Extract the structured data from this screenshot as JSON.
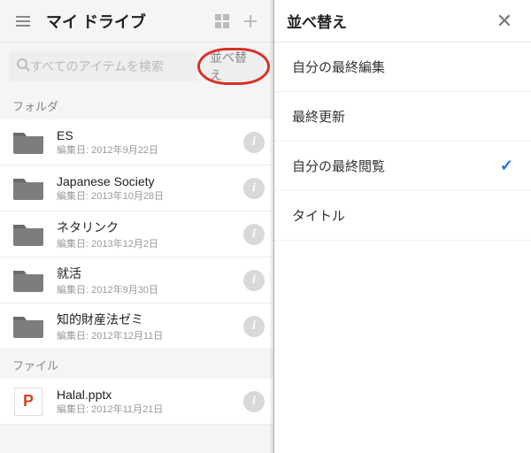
{
  "header": {
    "title": "マイ ドライブ"
  },
  "search": {
    "placeholder": "すべてのアイテムを検索",
    "sort_label": "並べ替え"
  },
  "sections": {
    "folders_label": "フォルダ",
    "files_label": "ファイル"
  },
  "folders": [
    {
      "title": "ES",
      "sub": "編集日: 2012年9月22日"
    },
    {
      "title": "Japanese Society",
      "sub": "編集日: 2013年10月28日"
    },
    {
      "title": "ネタリンク",
      "sub": "編集日: 2013年12月2日"
    },
    {
      "title": "就活",
      "sub": "編集日: 2012年9月30日"
    },
    {
      "title": "知的財産法ゼミ",
      "sub": "編集日: 2012年12月11日"
    }
  ],
  "files": [
    {
      "title": "Halal.pptx",
      "sub": "編集日: 2012年11月21日",
      "icon": "P"
    }
  ],
  "sort_panel": {
    "title": "並べ替え",
    "options": [
      {
        "label": "自分の最終編集",
        "selected": false
      },
      {
        "label": "最終更新",
        "selected": false
      },
      {
        "label": "自分の最終閲覧",
        "selected": true
      },
      {
        "label": "タイトル",
        "selected": false
      }
    ]
  },
  "colors": {
    "highlight_ring": "#d93025",
    "check": "#1a73e8"
  }
}
